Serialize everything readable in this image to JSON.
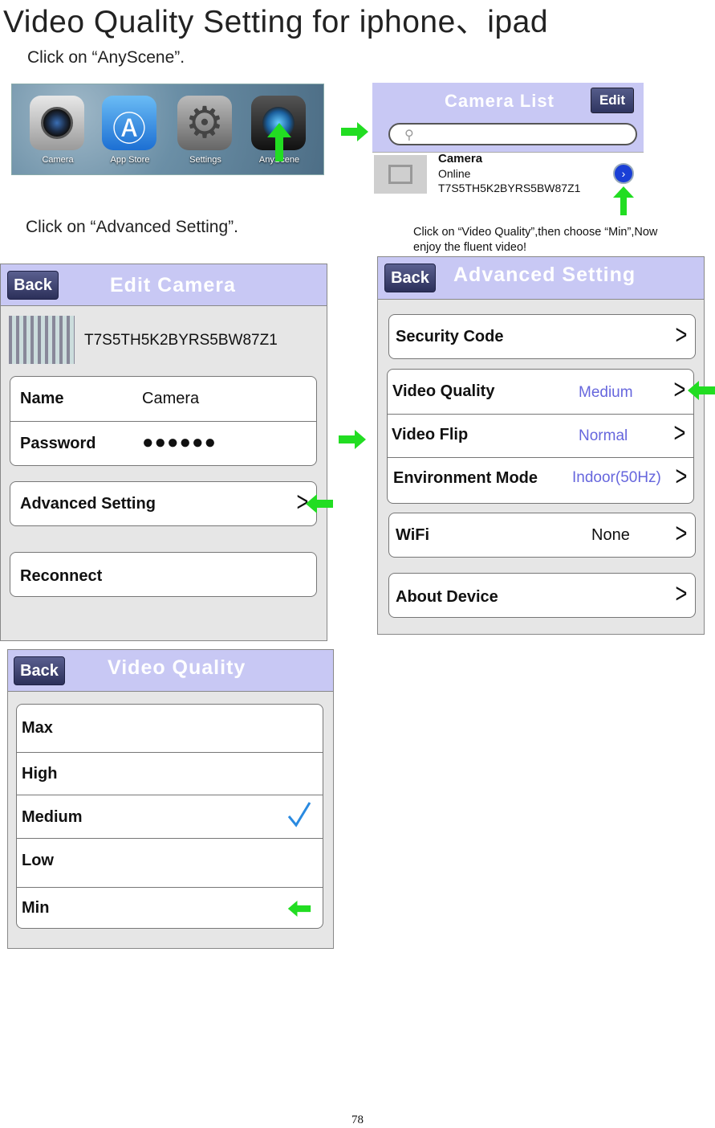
{
  "page_title": "Video Quality Setting for iphone、ipad",
  "step1_instruction": "Click on “AnyScene”.",
  "step2_instruction": "Click on “Advanced Setting”.",
  "step3_instruction": "Click on “Video Quality”,then choose “Min”,Now enjoy the fluent video!",
  "home_screen": {
    "apps": [
      {
        "label": "Camera"
      },
      {
        "label": "App Store"
      },
      {
        "label": "Settings"
      },
      {
        "label": "AnyScene"
      }
    ]
  },
  "camera_list": {
    "title": "Camera List",
    "edit_label": "Edit",
    "item": {
      "name": "Camera",
      "status": "Online",
      "uid": "T7S5TH5K2BYRS5BW87Z1"
    }
  },
  "edit_camera": {
    "back_label": "Back",
    "title": "Edit Camera",
    "uid": "T7S5TH5K2BYRS5BW87Z1",
    "name_label": "Name",
    "name_value": "Camera",
    "password_label": "Password",
    "password_value": "●●●●●●",
    "advanced_label": "Advanced Setting",
    "reconnect_label": "Reconnect"
  },
  "advanced_setting": {
    "back_label": "Back",
    "title": "Advanced Setting",
    "security_code_label": "Security Code",
    "video_quality_label": "Video Quality",
    "video_quality_value": "Medium",
    "video_flip_label": "Video Flip",
    "video_flip_value": "Normal",
    "environment_label": "Environment Mode",
    "environment_value": "Indoor(50Hz)",
    "wifi_label": "WiFi",
    "wifi_value": "None",
    "about_label": "About Device"
  },
  "video_quality": {
    "back_label": "Back",
    "title": "Video Quality",
    "options": [
      "Max",
      "High",
      "Medium",
      "Low",
      "Min"
    ],
    "selected": "Medium"
  },
  "page_number": "78",
  "colors": {
    "header_bg": "#c8c8f4",
    "button_bg": "#2c305a",
    "arrow_green": "#22dd22",
    "value_blue": "#6666dd",
    "check_blue": "#2a8ae0"
  }
}
